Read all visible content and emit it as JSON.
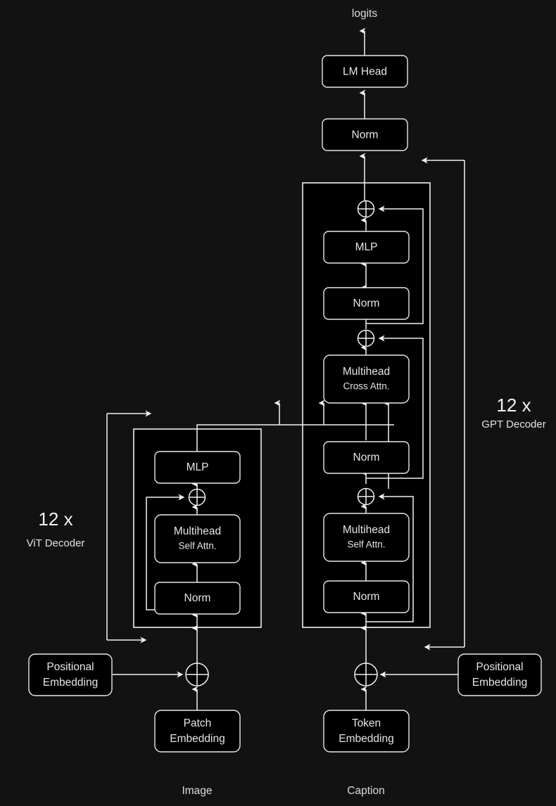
{
  "diagram": {
    "title_note": "Vision-encoder / GPT-decoder image captioning architecture",
    "background_color": "#121212",
    "node_fill": "#000000",
    "stroke_color": "#f2f2f2",
    "text_color": "#e6e6e6"
  },
  "labels": {
    "logits": "logits",
    "image": "Image",
    "caption": "Caption"
  },
  "vit": {
    "repeat_count": "12 x",
    "repeat_name": "ViT Decoder",
    "input_column_label": "Image",
    "blocks": {
      "mlp": "MLP",
      "attn_line1": "Multihead",
      "attn_line2": "Self Attn.",
      "norm": "Norm"
    },
    "embeddings": {
      "positional_line1": "Positional",
      "positional_line2": "Embedding",
      "patch_line1": "Patch",
      "patch_line2": "Embedding"
    }
  },
  "gpt": {
    "repeat_count": "12 x",
    "repeat_name": "GPT Decoder",
    "input_column_label": "Caption",
    "blocks": {
      "mlp": "MLP",
      "norm_top": "Norm",
      "cross_attn_line1": "Multihead",
      "cross_attn_line2": "Cross Attn.",
      "norm_mid": "Norm",
      "self_attn_line1": "Multihead",
      "self_attn_line2": "Self Attn.",
      "norm_bottom": "Norm"
    },
    "head": {
      "lm_head": "LM Head",
      "final_norm": "Norm",
      "output": "logits"
    },
    "embeddings": {
      "positional_line1": "Positional",
      "positional_line2": "Embedding",
      "token_line1": "Token",
      "token_line2": "Embedding"
    }
  }
}
